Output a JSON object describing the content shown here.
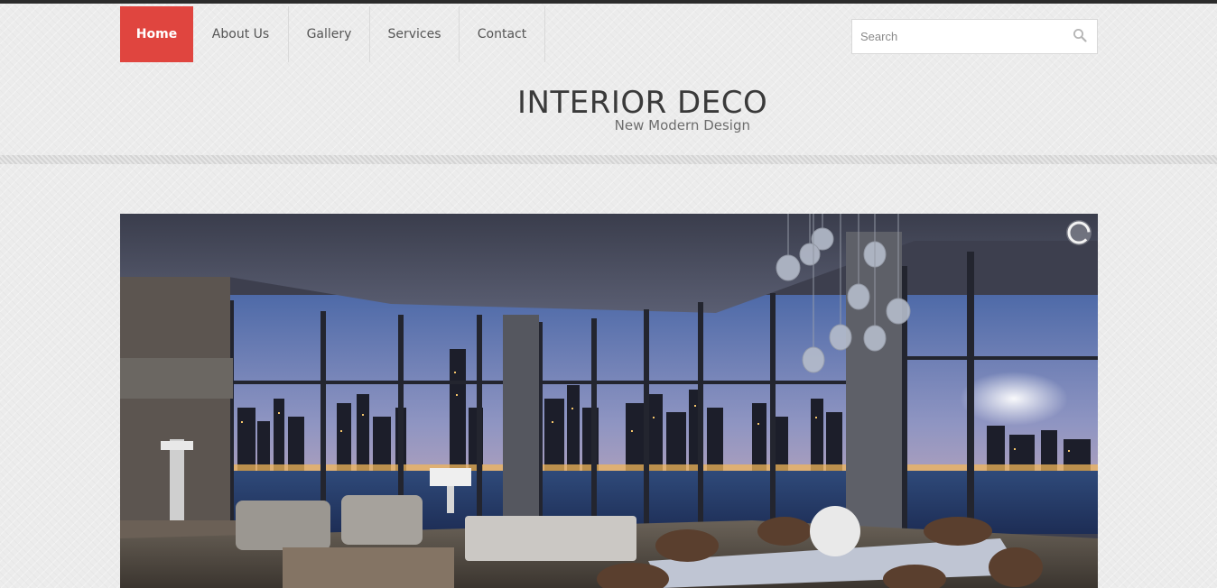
{
  "nav": {
    "items": [
      {
        "label": "Home",
        "active": true
      },
      {
        "label": "About Us",
        "active": false
      },
      {
        "label": "Gallery",
        "active": false
      },
      {
        "label": "Services",
        "active": false
      },
      {
        "label": "Contact",
        "active": false
      }
    ]
  },
  "search": {
    "placeholder": "Search",
    "icon": "search-icon"
  },
  "logo": {
    "title": "INTERIOR DECO",
    "subtitle": "New Modern Design"
  },
  "hero": {
    "timer_icon": "slider-timer-icon"
  },
  "colors": {
    "accent": "#e0453f",
    "topbar": "#2b2b2b",
    "background": "#ececec"
  }
}
